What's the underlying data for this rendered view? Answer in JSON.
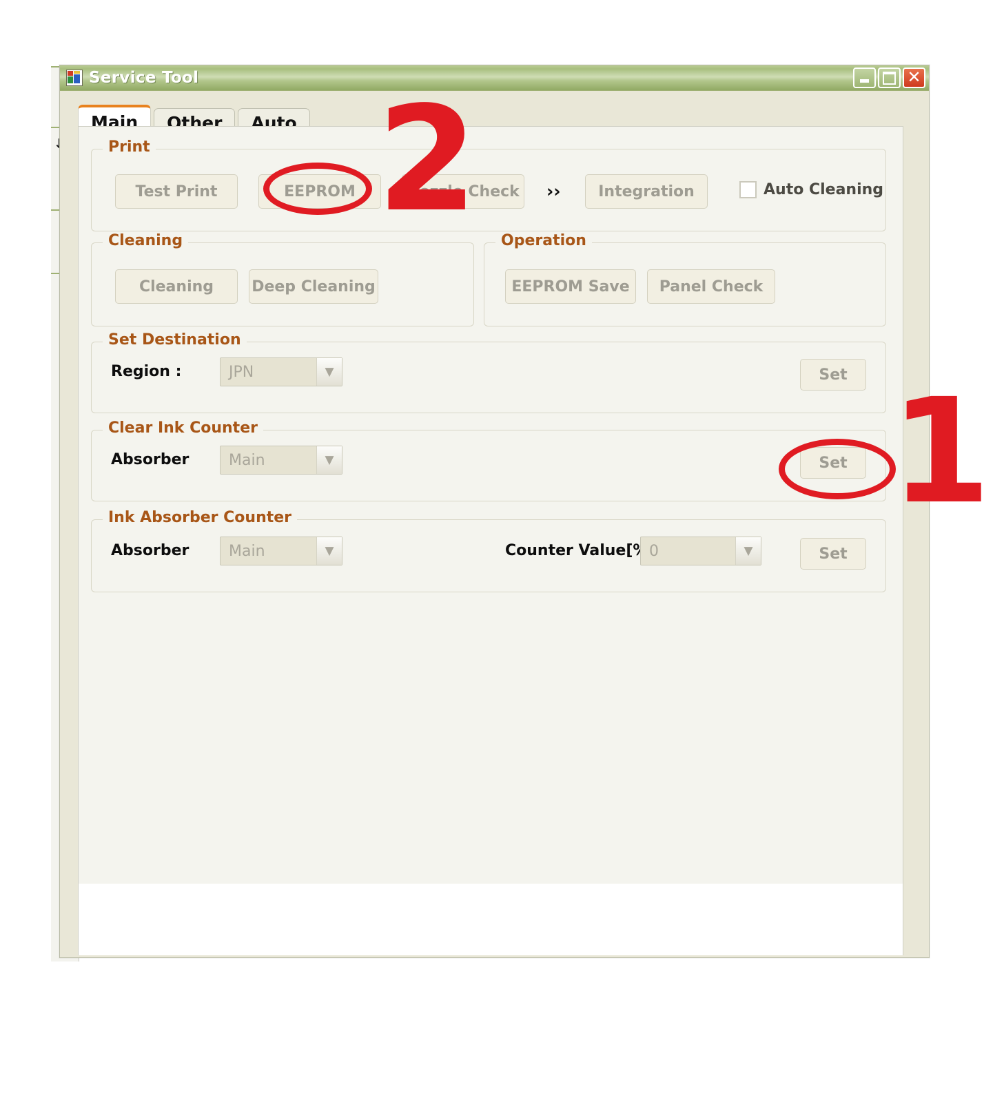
{
  "window": {
    "title": "Service Tool",
    "icon": "app-icon",
    "controls": {
      "minimize": "minimize",
      "maximize": "maximize",
      "close": "close"
    }
  },
  "tabs": [
    {
      "label": "Main",
      "active": true
    },
    {
      "label": "Other",
      "active": false
    },
    {
      "label": "Auto",
      "active": false
    }
  ],
  "background_window": {
    "glyph": "↓"
  },
  "groups": {
    "print": {
      "legend": "Print",
      "test_print": "Test Print",
      "eeprom": "EEPROM",
      "nozzle_check": "Nozzle Check",
      "chevron": "››",
      "integration": "Integration",
      "auto_cleaning": "Auto Cleaning",
      "auto_cleaning_checked": false
    },
    "cleaning": {
      "legend": "Cleaning",
      "cleaning": "Cleaning",
      "deep_cleaning": "Deep Cleaning"
    },
    "operation": {
      "legend": "Operation",
      "eeprom_save": "EEPROM Save",
      "panel_check": "Panel Check"
    },
    "set_destination": {
      "legend": "Set Destination",
      "region_label": "Region :",
      "region_value": "JPN",
      "set": "Set"
    },
    "clear_ink_counter": {
      "legend": "Clear Ink Counter",
      "absorber_label": "Absorber",
      "absorber_value": "Main",
      "set": "Set"
    },
    "ink_absorber_counter": {
      "legend": "Ink Absorber Counter",
      "absorber_label": "Absorber",
      "absorber_value": "Main",
      "counter_label": "Counter Value[%]",
      "counter_value": "0",
      "set": "Set"
    }
  },
  "annotations": [
    {
      "name": "step-2",
      "text": "2"
    },
    {
      "name": "step-1",
      "text": "1"
    }
  ],
  "colors": {
    "annotation_red": "#e01b22",
    "legend_orange": "#a85617",
    "tab_accent": "#e8821e",
    "titlebar_green": "#a8bf7f",
    "panel_bg": "#f4f4ee",
    "button_bg": "#f2efe2",
    "combo_bg": "#e6e3d2"
  }
}
